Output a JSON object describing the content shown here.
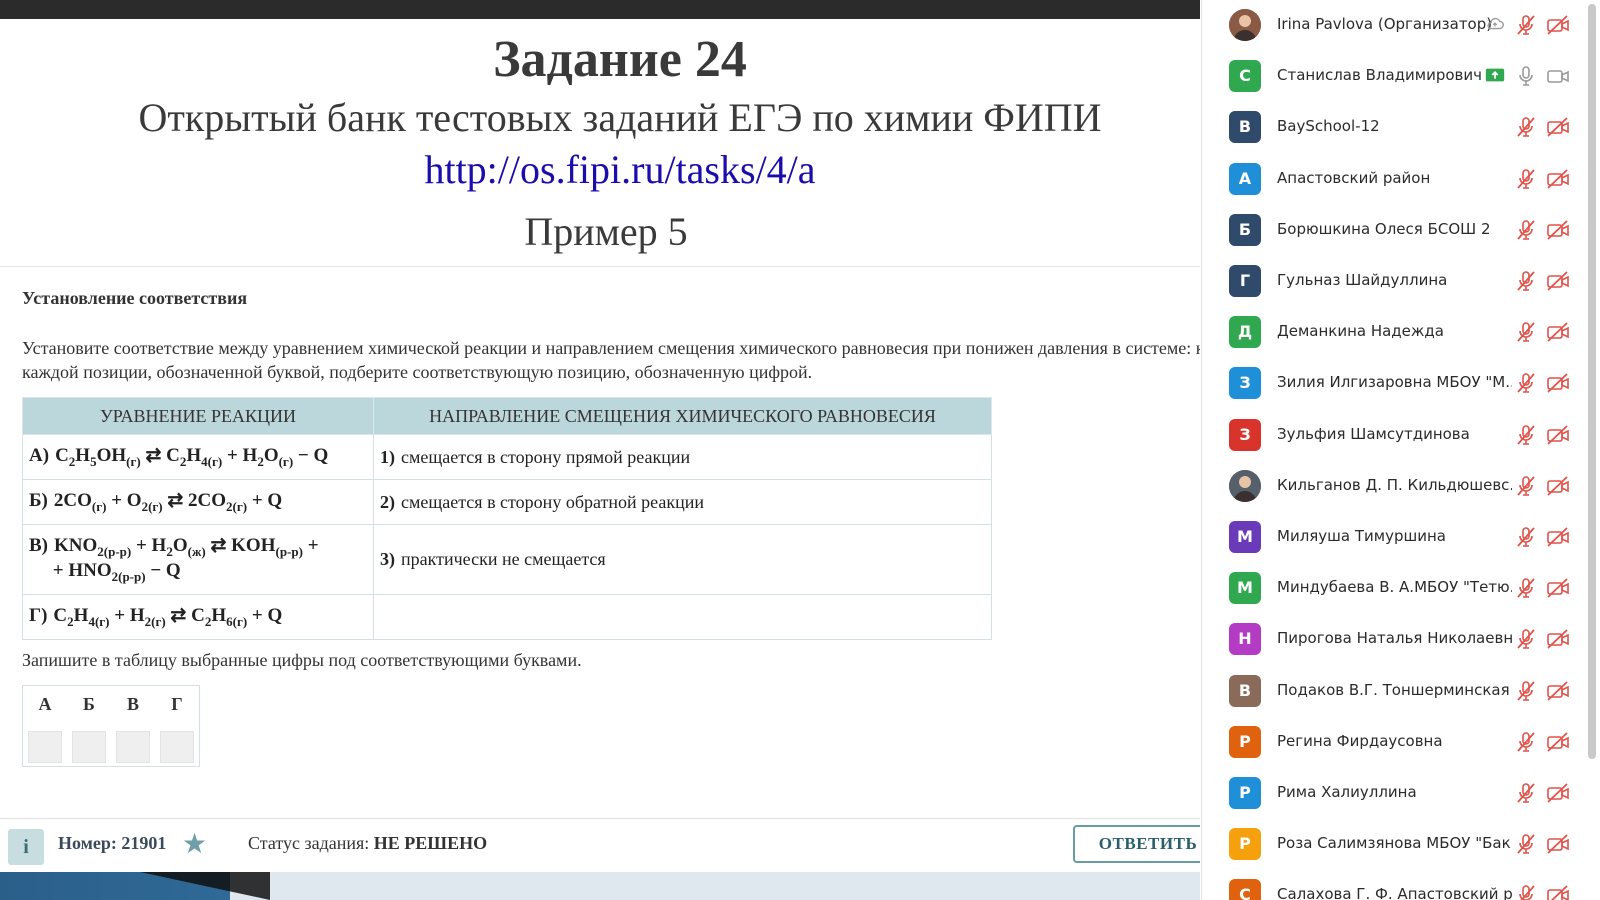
{
  "slide": {
    "title": "Задание 24",
    "subtitle": "Открытый банк тестовых заданий ЕГЭ по химии ФИПИ",
    "link": "http://os.fipi.ru/tasks/4/a",
    "example": "Пример 5"
  },
  "task": {
    "heading": "Установление соответствия",
    "text": "Установите соответствие между уравнением химической реакции и направлением смещения химического равновесия при понижен давления в системе: к каждой позиции, обозначенной буквой, подберите соответствующую позицию, обозначенную цифрой.",
    "col1_header": "УРАВНЕНИЕ РЕАКЦИИ",
    "col2_header": "НАПРАВЛЕНИЕ СМЕЩЕНИЯ ХИМИЧЕСКОГО РАВНОВЕСИЯ",
    "rows": [
      {
        "letter": "А)",
        "num": "1)",
        "answer": "смещается в сторону прямой реакции"
      },
      {
        "letter": "Б)",
        "num": "2)",
        "answer": "смещается в сторону обратной реакции"
      },
      {
        "letter": "В)",
        "num": "3)",
        "answer": "практически не смещается"
      },
      {
        "letter": "Г)",
        "num": "",
        "answer": ""
      }
    ],
    "instruction": "Запишите в таблицу выбранные цифры под соответствующими буквами.",
    "answer_letters": [
      "А",
      "Б",
      "В",
      "Г"
    ]
  },
  "footer": {
    "number_label": "Номер: 21901",
    "status_prefix": "Статус задания: ",
    "status_value": "НЕ РЕШЕНО",
    "answer_button": "ОТВЕТИТЬ",
    "info_icon": "i"
  },
  "participants": [
    {
      "initial": "",
      "name": "Irina Pavlova (Организатор)",
      "color": "#8a5a44",
      "photo": true
    },
    {
      "initial": "С",
      "name": "Станислав Владимирович ...",
      "color": "#2fa84f"
    },
    {
      "initial": "В",
      "name": "BaySchool-12",
      "color": "#2f4a6a"
    },
    {
      "initial": "А",
      "name": "Апастовский район",
      "color": "#1f8fd8"
    },
    {
      "initial": "Б",
      "name": "Борюшкина Олеся БСОШ 2",
      "color": "#2f4a6a"
    },
    {
      "initial": "Г",
      "name": "Гульназ Шайдуллина",
      "color": "#2f4a6a"
    },
    {
      "initial": "Д",
      "name": "Деманкина Надежда",
      "color": "#2fa84f"
    },
    {
      "initial": "З",
      "name": "Зилия Илгизаровна МБОУ \"М...",
      "color": "#1f8fd8"
    },
    {
      "initial": "З",
      "name": "Зульфия Шамсутдинова",
      "color": "#d9342b"
    },
    {
      "initial": "",
      "name": "Кильганов Д. П.  Кильдюшевс...",
      "color": "#55606b",
      "photo": true
    },
    {
      "initial": "М",
      "name": "Миляуша Тимуршина",
      "color": "#6a3bb8"
    },
    {
      "initial": "М",
      "name": "Миндубаева В. А.МБОУ \"Тетю...",
      "color": "#2fa84f"
    },
    {
      "initial": "Н",
      "name": "Пирогова Наталья Николаевн...",
      "color": "#b43bc4"
    },
    {
      "initial": "В",
      "name": "Подаков В.Г. Тоншерминская ...",
      "color": "#8a6b5a"
    },
    {
      "initial": "Р",
      "name": "Регина Фирдаусовна",
      "color": "#e0620e"
    },
    {
      "initial": "Р",
      "name": "Рима Халиуллина",
      "color": "#1f8fd8"
    },
    {
      "initial": "Р",
      "name": "Роза Салимзянова МБОУ \"Бак...",
      "color": "#f5a00c"
    },
    {
      "initial": "С",
      "name": "Салахова Г. Ф. Апастовский р-...",
      "color": "#e0620e"
    }
  ],
  "colors": {
    "muted_red": "#e0524a",
    "gray_icon": "#9a9a9a",
    "share_green": "#2fa84f"
  }
}
